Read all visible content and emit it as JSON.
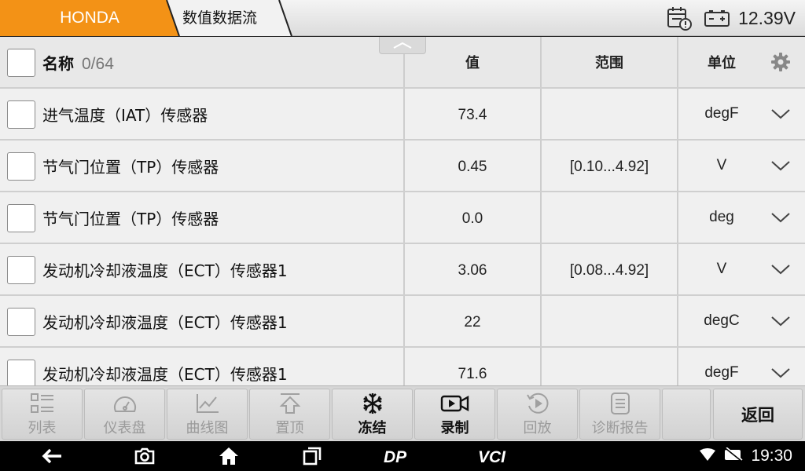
{
  "header": {
    "brand": "HONDA",
    "page_title": "数值数据流",
    "voltage": "12.39V",
    "colors": {
      "brand_tab": "#f39216"
    }
  },
  "table": {
    "columns": {
      "name": "名称",
      "count": "0/64",
      "value": "值",
      "range": "范围",
      "unit": "单位"
    },
    "rows": [
      {
        "name": "进气温度（IAT）传感器",
        "value": "73.4",
        "range": "",
        "unit": "degF"
      },
      {
        "name": "节气门位置（TP）传感器",
        "value": "0.45",
        "range": "[0.10...4.92]",
        "unit": "V"
      },
      {
        "name": "节气门位置（TP）传感器",
        "value": "0.0",
        "range": "",
        "unit": "deg"
      },
      {
        "name": "发动机冷却液温度（ECT）传感器1",
        "value": "3.06",
        "range": "[0.08...4.92]",
        "unit": "V"
      },
      {
        "name": "发动机冷却液温度（ECT）传感器1",
        "value": "22",
        "range": "",
        "unit": "degC"
      },
      {
        "name": "发动机冷却液温度（ECT）传感器1",
        "value": "71.6",
        "range": "",
        "unit": "degF"
      }
    ]
  },
  "toolbar": {
    "list": "列表",
    "gauge": "仪表盘",
    "graph": "曲线图",
    "pin": "置顶",
    "freeze": "冻结",
    "record": "录制",
    "playback": "回放",
    "report": "诊断报告",
    "back": "返回"
  },
  "navbar": {
    "brand_dp": "DP",
    "brand_vci": "VCI",
    "clock": "19:30"
  }
}
